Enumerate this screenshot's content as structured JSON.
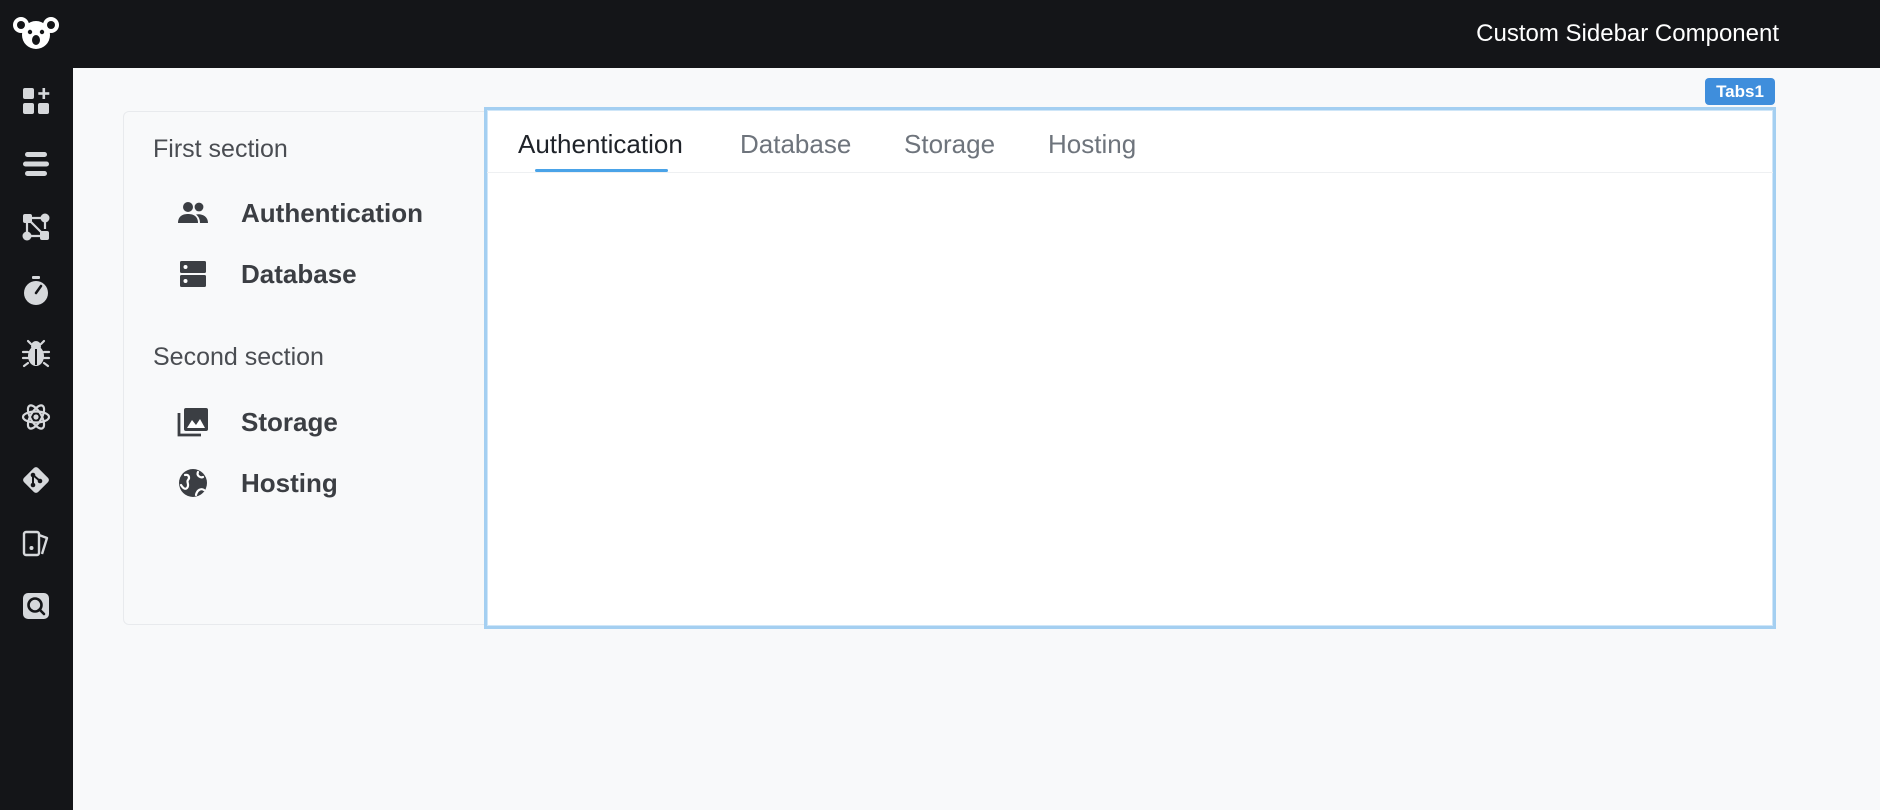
{
  "header": {
    "title": "Custom Sidebar Component"
  },
  "rail": {
    "icons": [
      "widget-add-icon",
      "stack-icon",
      "workflow-icon",
      "timer-icon",
      "bug-icon",
      "atom-icon",
      "git-icon",
      "theme-icon",
      "inspect-icon"
    ]
  },
  "component_tag": "Tabs1",
  "sidebar": {
    "sections": [
      {
        "title": "First section",
        "items": [
          {
            "label": "Authentication",
            "icon": "people-icon"
          },
          {
            "label": "Database",
            "icon": "database-icon"
          }
        ]
      },
      {
        "title": "Second section",
        "items": [
          {
            "label": "Storage",
            "icon": "photo-library-icon"
          },
          {
            "label": "Hosting",
            "icon": "globe-icon"
          }
        ]
      }
    ]
  },
  "tabs": {
    "active": "Authentication",
    "items": [
      {
        "label": "Authentication"
      },
      {
        "label": "Database"
      },
      {
        "label": "Storage"
      },
      {
        "label": "Hosting"
      }
    ]
  },
  "colors": {
    "chrome": "#141518",
    "accent": "#4aa3e8",
    "tag": "#3f8edc",
    "panel_border": "#a4cff1"
  }
}
